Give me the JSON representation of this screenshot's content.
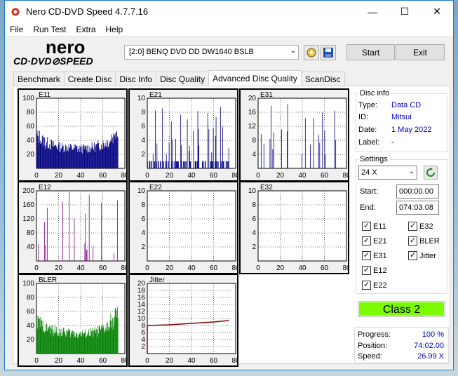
{
  "window": {
    "title": "Nero CD-DVD Speed 4.7.7.16",
    "minimize": "—",
    "maximize": "☐",
    "close": "✕"
  },
  "menu": [
    "File",
    "Run Test",
    "Extra",
    "Help"
  ],
  "toolbar": {
    "drive": "[2:0]   BENQ DVD DD DW1640 BSLB",
    "drive_arrow": "⌄",
    "start_label": "Start",
    "exit_label": "Exit",
    "logo_nero": "nero",
    "logo_cd": "CD·DVD⊘SPEED"
  },
  "tabs": [
    "Benchmark",
    "Create Disc",
    "Disc Info",
    "Disc Quality",
    "Advanced Disc Quality",
    "ScanDisc"
  ],
  "active_tab": 4,
  "disc_info": {
    "legend": "Disc info",
    "type_label": "Type:",
    "type": "Data CD",
    "id_label": "ID:",
    "id": "Mitsui",
    "date_label": "Date:",
    "date": "1 May 2022",
    "label_label": "Label:",
    "label": "-"
  },
  "settings": {
    "legend": "Settings",
    "speed": "24 X",
    "start_label": "Start:",
    "start": "000:00.00",
    "end_label": "End:",
    "end": "074:03.08",
    "checkboxes": [
      {
        "label": "E11",
        "checked": true
      },
      {
        "label": "E32",
        "checked": true
      },
      {
        "label": "E21",
        "checked": true
      },
      {
        "label": "BLER",
        "checked": true
      },
      {
        "label": "E31",
        "checked": true
      },
      {
        "label": "Jitter",
        "checked": true
      },
      {
        "label": "E12",
        "checked": true
      },
      {
        "label": "E22",
        "checked": true
      }
    ]
  },
  "class": "Class 2",
  "stats": {
    "progress_label": "Progress:",
    "progress": "100 %",
    "position_label": "Position:",
    "position": "74:02.00",
    "speed_label": "Speed:",
    "speed": "26.99 X"
  },
  "chart_data": [
    {
      "name": "E11",
      "type": "bar",
      "color": "#000080",
      "ylim": [
        0,
        100
      ],
      "yticks": [
        20,
        40,
        60,
        80,
        100
      ],
      "xticks": [
        0,
        20,
        40,
        60,
        80
      ],
      "profile": [
        45,
        40,
        36,
        34,
        32,
        31,
        30,
        30,
        29,
        29,
        28,
        28,
        29,
        30,
        31,
        33,
        35,
        38,
        45,
        55
      ]
    },
    {
      "name": "E21",
      "type": "bar",
      "color": "#000080",
      "ylim": [
        0,
        10
      ],
      "yticks": [
        2,
        4,
        6,
        8,
        10
      ],
      "xticks": [
        0,
        20,
        40,
        60,
        80
      ],
      "profile": [
        1,
        1,
        1,
        1,
        1,
        1,
        1,
        1,
        1,
        1,
        1,
        1,
        1,
        1,
        1,
        1,
        1,
        1,
        1,
        1
      ]
    },
    {
      "name": "E31",
      "type": "bar",
      "color": "#000080",
      "ylim": [
        0,
        20
      ],
      "yticks": [
        4,
        8,
        12,
        16,
        20
      ],
      "xticks": [
        0,
        20,
        40,
        60,
        80
      ],
      "profile": [
        0,
        0,
        0,
        0,
        0,
        0,
        0,
        0,
        0,
        0,
        0,
        0,
        0,
        0,
        0,
        0,
        0,
        0,
        0,
        0
      ]
    },
    {
      "name": "E12",
      "type": "bar",
      "color": "#800080",
      "ylim": [
        0,
        200
      ],
      "yticks": [
        40,
        80,
        120,
        160,
        200
      ],
      "xticks": [
        0,
        20,
        40,
        60,
        80
      ],
      "profile": [
        0,
        0,
        0,
        0,
        0,
        0,
        0,
        0,
        0,
        0,
        0,
        0,
        0,
        0,
        0,
        0,
        0,
        0,
        0,
        0
      ]
    },
    {
      "name": "E22",
      "type": "bar",
      "color": "#000080",
      "ylim": [
        0,
        10
      ],
      "yticks": [
        2,
        4,
        6,
        8,
        10
      ],
      "xticks": [
        0,
        20,
        40,
        60,
        80
      ],
      "profile": []
    },
    {
      "name": "E32",
      "type": "bar",
      "color": "#000080",
      "ylim": [
        0,
        10
      ],
      "yticks": [
        2,
        4,
        6,
        8,
        10
      ],
      "xticks": [
        0,
        20,
        40,
        60,
        80
      ],
      "profile": []
    },
    {
      "name": "BLER",
      "type": "bar",
      "color": "#008000",
      "ylim": [
        0,
        100
      ],
      "yticks": [
        20,
        40,
        60,
        80,
        100
      ],
      "xticks": [
        0,
        20,
        40,
        60,
        80
      ],
      "profile": [
        45,
        40,
        36,
        34,
        32,
        31,
        30,
        30,
        29,
        29,
        28,
        28,
        29,
        30,
        31,
        33,
        35,
        38,
        45,
        55
      ]
    },
    {
      "name": "Jitter",
      "type": "line",
      "color": "#800000",
      "ylim": [
        0,
        20
      ],
      "yticks": [
        2,
        4,
        6,
        8,
        10,
        12,
        14,
        16,
        18,
        20
      ],
      "xticks": [
        0,
        20,
        40,
        60,
        80
      ],
      "x": [
        0,
        10,
        20,
        30,
        40,
        50,
        60,
        70,
        74
      ],
      "values": [
        8.0,
        8.1,
        8.2,
        8.4,
        8.6,
        8.8,
        9.0,
        9.3,
        9.4
      ]
    }
  ]
}
